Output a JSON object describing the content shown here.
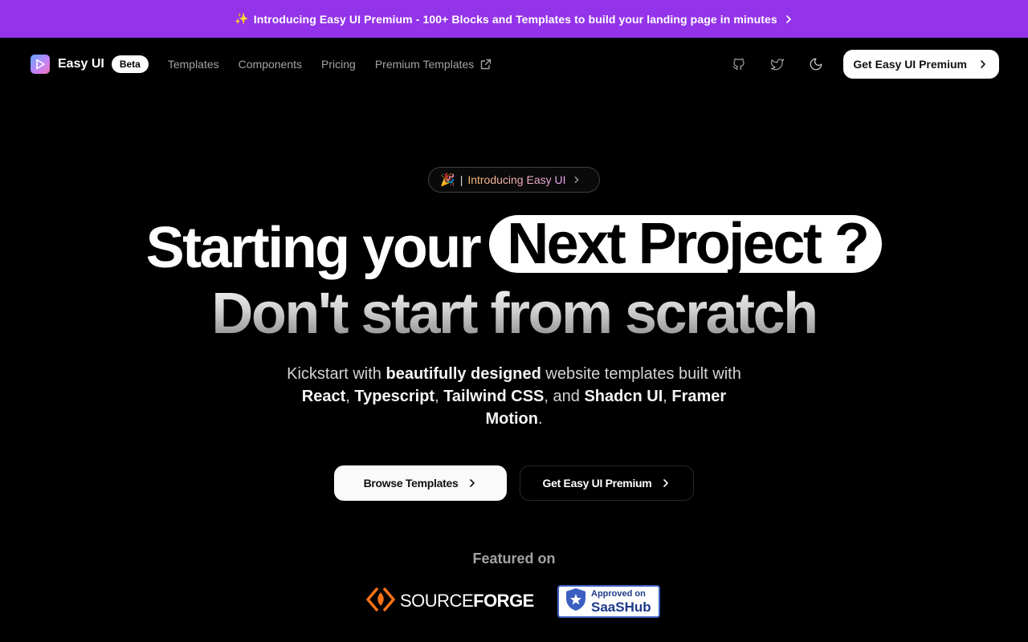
{
  "announcement": {
    "emoji": "✨",
    "text": "Introducing Easy UI Premium - 100+ Blocks and Templates to build your landing page in minutes"
  },
  "nav": {
    "brand": "Easy UI",
    "badge": "Beta",
    "links": [
      {
        "label": "Templates"
      },
      {
        "label": "Components"
      },
      {
        "label": "Pricing"
      },
      {
        "label": "Premium Templates"
      }
    ],
    "cta": "Get Easy UI Premium"
  },
  "hero": {
    "pill_emoji": "🎉",
    "pill_separator": "|",
    "pill_label": "Introducing Easy UI",
    "line1_plain": "Starting your",
    "line1_highlight": "Next Project ?",
    "line2": "Don't start from scratch",
    "subtitle": {
      "p1": "Kickstart with ",
      "b1": "beautifully designed",
      "p2": " website templates built with ",
      "b2": "React",
      "p3": ", ",
      "b3": "Typescript",
      "p4": ", ",
      "b4": "Tailwind CSS",
      "p5": ", and ",
      "b5": "Shadcn UI",
      "p6": ", ",
      "b6": "Framer Motion",
      "p7": "."
    },
    "primary_button": "Browse Templates",
    "secondary_button": "Get Easy UI Premium"
  },
  "featured": {
    "title": "Featured on",
    "sourceforge_thin": "SOURCE",
    "sourceforge_bold": "FORGE",
    "saashub_line1": "Approved on",
    "saashub_line2": "SaaSHub"
  },
  "colors": {
    "announcement_bg": "#9333ea",
    "background": "#000000",
    "sourceforge_orange": "#f97316",
    "saashub_blue": "#1e3a8a"
  }
}
